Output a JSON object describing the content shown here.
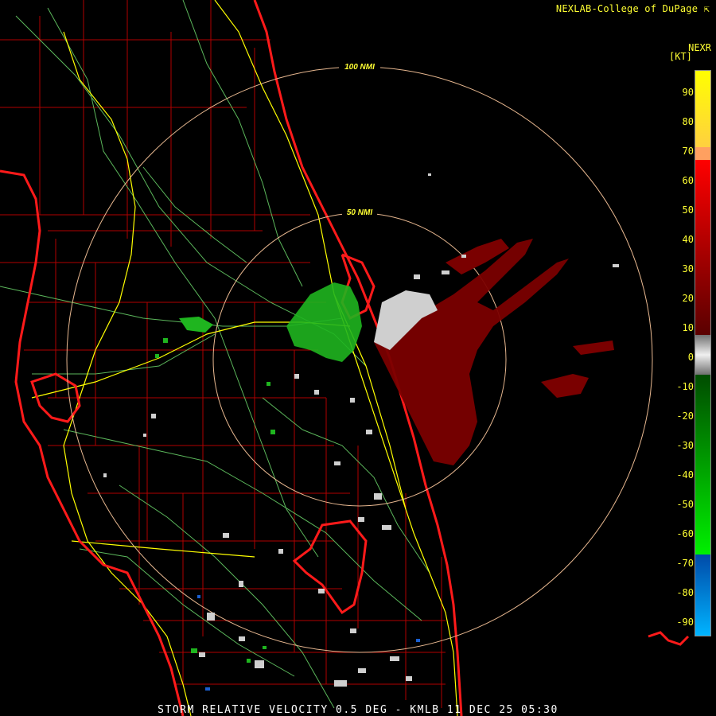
{
  "header": {
    "credit": "NEXLAB-College of DuPage",
    "product": "NEXR",
    "unit": "[KT]"
  },
  "footer": {
    "caption": "STORM RELATIVE VELOCITY 0.5 DEG - KMLB 11 DEC 25 05:30"
  },
  "range_rings": [
    {
      "label": "50 NMI"
    },
    {
      "label": "100 NMI"
    }
  ],
  "legend": {
    "ticks": [
      "90",
      "80",
      "70",
      "60",
      "50",
      "40",
      "30",
      "20",
      "10",
      "0",
      "-10",
      "-20",
      "-30",
      "-40",
      "-50",
      "-60",
      "-70",
      "-80",
      "-90"
    ],
    "colors": {
      "top_yellow": "#ffff00",
      "orange": "#ffa060",
      "red": "#ff0000",
      "dark_red": "#7a0000",
      "gray": "#9a9a9a",
      "white": "#e6e6e6",
      "dark_green": "#005a00",
      "green": "#00e000",
      "blue": "#0060c0",
      "light_blue": "#00aaff"
    }
  },
  "map_colors": {
    "coastline": "#ff1a1a",
    "county_lines": "#b00000",
    "roads_major": "#ffff00",
    "roads_minor": "#66cc66",
    "rings": "#e8b890"
  }
}
